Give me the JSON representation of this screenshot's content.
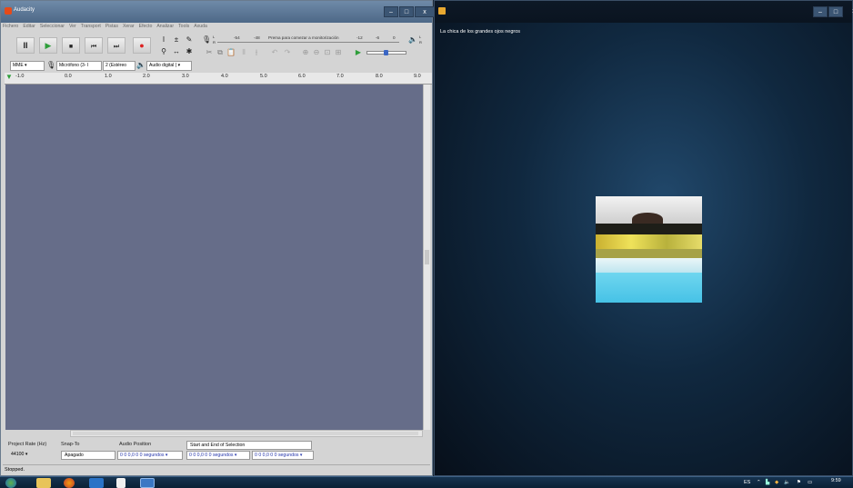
{
  "audacity": {
    "title": "Audacity",
    "menu": [
      "Fichero",
      "Editar",
      "Seleccionar",
      "Ver",
      "Transport",
      "Pistas",
      "Xerar",
      "Efecto",
      "Analizar",
      "Tools",
      "Axuda"
    ],
    "meter": {
      "record_hint": "Prema para comezar a monitorización",
      "ticks": [
        "-54",
        "-48",
        "-12",
        "-6",
        "0"
      ],
      "l_label": "L",
      "r_label": "R"
    },
    "device": {
      "host": "MME",
      "mic": "Micrófono (3- I",
      "channels": "2 (Estéreo",
      "output": "Audio digital ("
    },
    "ruler_ticks": [
      "-1.0",
      "0.0",
      "1.0",
      "2.0",
      "3.0",
      "4.0",
      "5.0",
      "6.0",
      "7.0",
      "8.0",
      "9.0"
    ],
    "selection": {
      "project_rate_label": "Project Rate (Hz)",
      "project_rate_value": "44100",
      "snap_label": "Snap-To",
      "snap_value": "Apagado",
      "audio_position_label": "Audio Position",
      "audio_position_value": "0 0 0,0 0 0 segundos",
      "range_label": "Start and End of Selection",
      "start_value": "0 0 0,0 0 0 segundos",
      "end_value": "0 0 0,0 0 0 segundos"
    },
    "status": "Stopped."
  },
  "viewer": {
    "title": "La chica de los grandes ojos negros"
  },
  "taskbar": {
    "lang": "ES",
    "time": "9:59"
  },
  "colors": {
    "track_bg": "#666d89",
    "titlebar": "#5a7595",
    "taskbar": "#0b2136"
  }
}
